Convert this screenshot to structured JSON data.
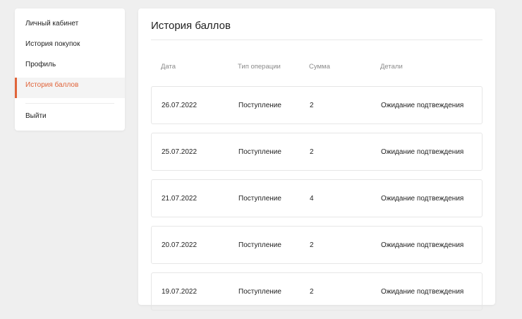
{
  "sidebar": {
    "items": [
      {
        "label": "Личный кабинет"
      },
      {
        "label": "История покупок"
      },
      {
        "label": "Профиль"
      },
      {
        "label": "История баллов"
      }
    ],
    "logout": "Выйти"
  },
  "main": {
    "title": "История баллов",
    "headers": {
      "date": "Дата",
      "type": "Тип операции",
      "amount": "Сумма",
      "details": "Детали"
    },
    "rows": [
      {
        "date": "26.07.2022",
        "type": "Поступление",
        "amount": "2",
        "details": "Ожидание подтвеждения"
      },
      {
        "date": "25.07.2022",
        "type": "Поступление",
        "amount": "2",
        "details": "Ожидание подтвеждения"
      },
      {
        "date": "21.07.2022",
        "type": "Поступление",
        "amount": "4",
        "details": "Ожидание подтвеждения"
      },
      {
        "date": "20.07.2022",
        "type": "Поступление",
        "amount": "2",
        "details": "Ожидание подтвеждения"
      },
      {
        "date": "19.07.2022",
        "type": "Поступление",
        "amount": "2",
        "details": "Ожидание подтвеждения"
      }
    ]
  },
  "colors": {
    "accent": "#e0643a",
    "background": "#efefef"
  }
}
